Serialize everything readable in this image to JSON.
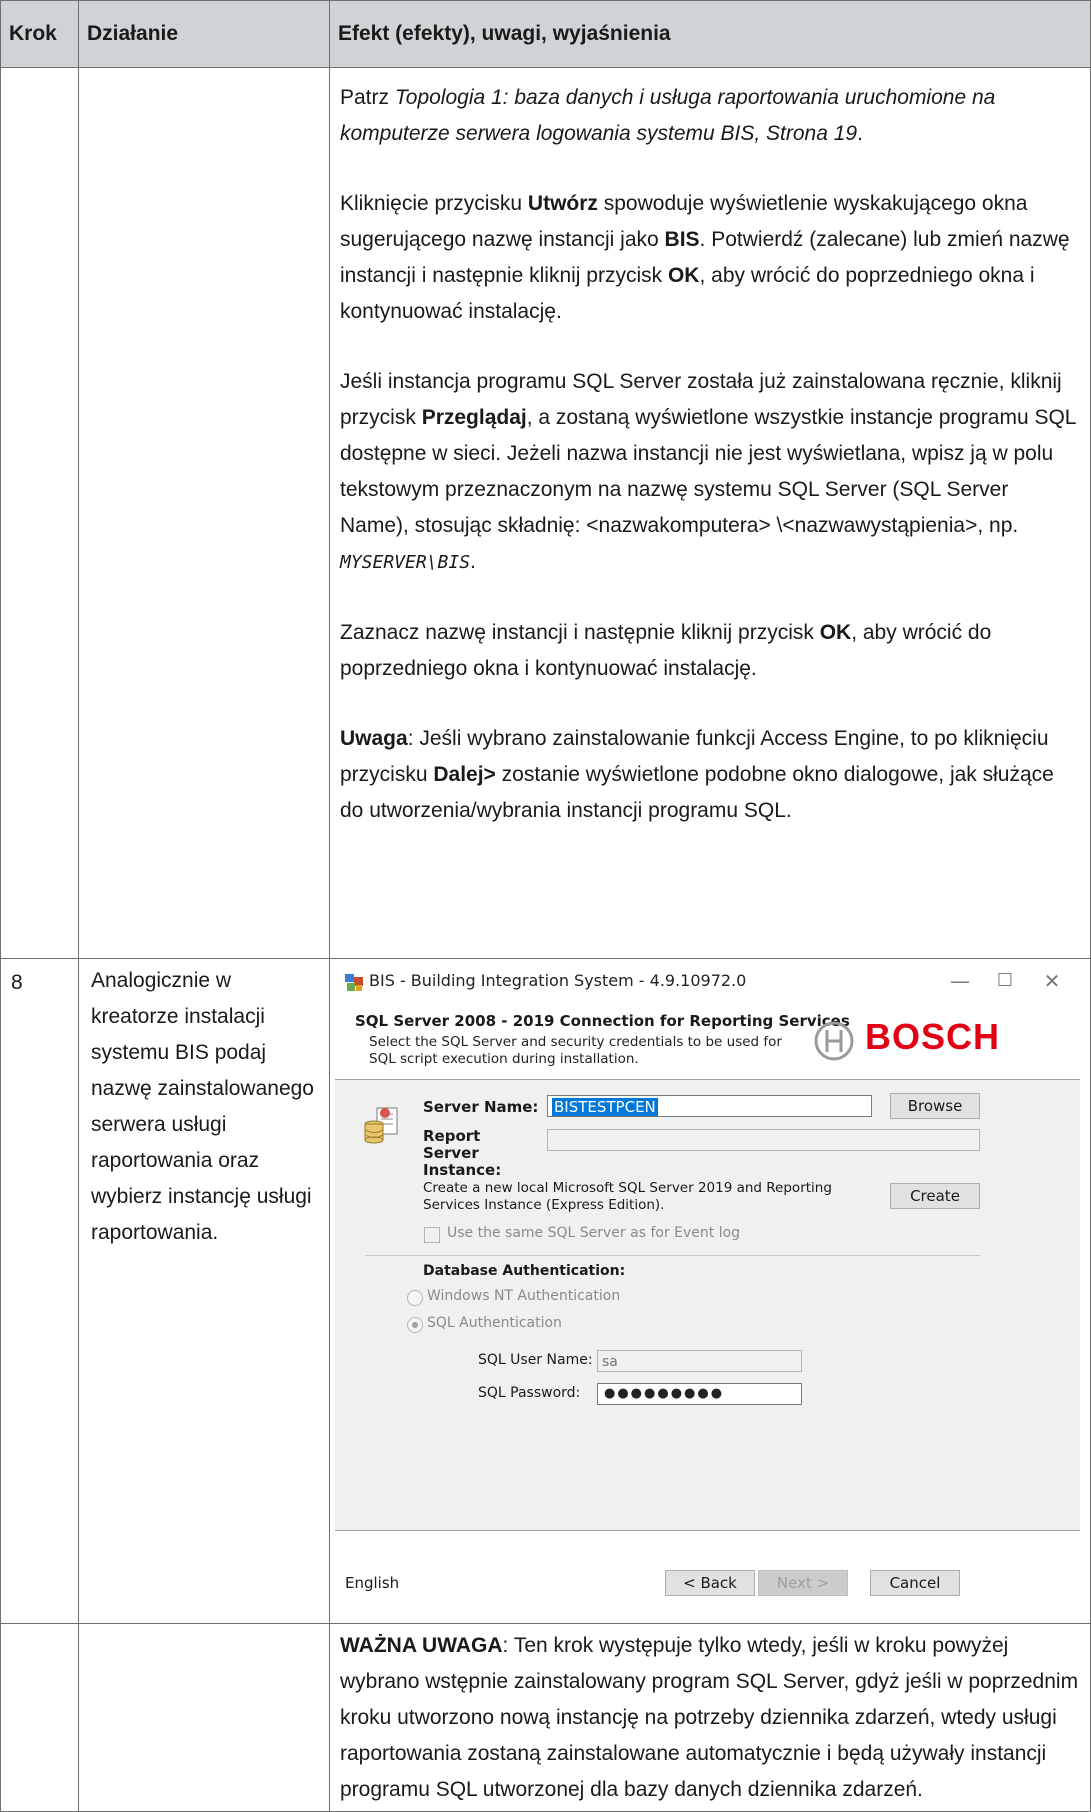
{
  "header": {
    "col1": "Krok",
    "col2": "Działanie",
    "col3": "Efekt (efekty), uwagi, wyjaśnienia"
  },
  "row1": {
    "p1": {
      "a": "Patrz  ",
      "b": "Topologia 1: baza danych i usługa raportowania uruchomione na komputerze serwera logowania systemu BIS, Strona 19",
      "c": "."
    },
    "p2": {
      "a": "Kliknięcie przycisku ",
      "b": "Utwórz",
      "c": " spowoduje wyświetlenie wyskakującego okna sugerującego nazwę instancji jako ",
      "d": "BIS",
      "e": ". Potwierdź (zalecane) lub zmień nazwę instancji i następnie kliknij przycisk ",
      "f": "OK",
      "g": ", aby wrócić do poprzedniego okna i kontynuować instalację."
    },
    "p3": {
      "a": "Jeśli instancja programu SQL Server została już zainstalowana ręcznie, kliknij przycisk ",
      "b": "Przeglądaj",
      "c": ", a zostaną wyświetlone wszystkie instancje programu SQL dostępne w sieci. Jeżeli nazwa instancji nie jest wyświetlana, wpisz ją w polu tekstowym przeznaczonym na nazwę systemu SQL Server (SQL Server Name), stosując składnię: <nazwakomputera> \\<nazwawystąpienia>, np. ",
      "d": "MYSERVER\\BIS",
      "e": "."
    },
    "p4": {
      "a": "Zaznacz nazwę instancji i następnie kliknij przycisk ",
      "b": "OK",
      "c": ", aby wrócić do poprzedniego okna i kontynuować instalację."
    },
    "p5": {
      "a": "Uwaga",
      "b": ": Jeśli wybrano zainstalowanie funkcji Access Engine, to po kliknięciu przycisku ",
      "c": "Dalej>",
      "d": " zostanie wyświetlone podobne okno dialogowe, jak służące do utworzenia/wybrania instancji programu SQL."
    }
  },
  "row2": {
    "step": "8",
    "action": "Analogicznie w kreatorze instalacji systemu BIS podaj nazwę zainstalowanego serwera usługi raportowania oraz wybierz instancję usługi raportowania.",
    "dialog": {
      "window_title": "BIS - Building Integration System - 4.9.10972.0",
      "min": "—",
      "max": "☐",
      "close": "✕",
      "header_title": "SQL Server 2008 - 2019 Connection for Reporting Services",
      "header_sub": "Select the SQL Server and security credentials to be used for SQL script execution during installation.",
      "brand": "BOSCH",
      "server_name_label": "Server Name:",
      "server_name_value": "BISTESTPCEN",
      "browse": "Browse",
      "report_server_label": "Report Server Instance:",
      "create_text": "Create a new local Microsoft SQL Server 2019 and Reporting Services Instance (Express Edition).",
      "create": "Create",
      "same_sql": "Use the same SQL Server as for Event log",
      "db_auth": "Database Authentication:",
      "win_auth": "Windows NT Authentication",
      "sql_auth": "SQL Authentication",
      "sql_user_label": "SQL User Name:",
      "sql_user_value": "sa",
      "sql_pass_label": "SQL Password:",
      "sql_pass_value": "●●●●●●●●●",
      "language": "English",
      "back": "< Back",
      "next": "Next >",
      "cancel": "Cancel",
      "colors": {
        "brand_red": "#e20015",
        "selection_blue": "#0078d7"
      }
    }
  },
  "row3": {
    "a": "WAŻNA UWAGA",
    "b": ": Ten krok występuje tylko wtedy, jeśli w kroku powyżej wybrano wstępnie zainstalowany program SQL Server, gdyż jeśli w poprzednim kroku utworzono nową instancję na potrzeby dziennika zdarzeń, wtedy usługi raportowania zostaną zainstalowane automatycznie i będą używały instancji programu SQL utworzonej dla bazy danych dziennika zdarzeń."
  }
}
